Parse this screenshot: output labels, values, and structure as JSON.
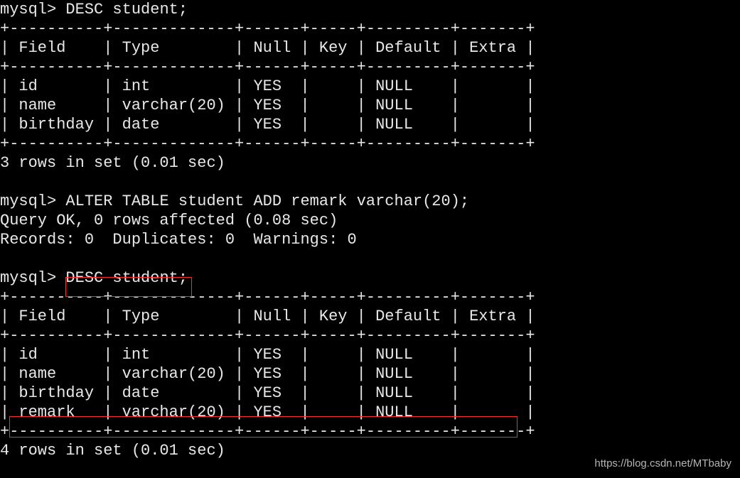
{
  "prompt": "mysql>",
  "cmd1": "DESC student;",
  "sep1": "+----------+-------------+------+-----+---------+-------+",
  "hdr1": "| Field    | Type        | Null | Key | Default | Extra |",
  "t1r1": "| id       | int         | YES  |     | NULL    |       |",
  "t1r2": "| name     | varchar(20) | YES  |     | NULL    |       |",
  "t1r3": "| birthday | date        | YES  |     | NULL    |       |",
  "res1": "3 rows in set (0.01 sec)",
  "cmd2": "ALTER TABLE student ADD remark varchar(20);",
  "ok2": "Query OK, 0 rows affected (0.08 sec)",
  "rec2": "Records: 0  Duplicates: 0  Warnings: 0",
  "cmd3": "DESC student;",
  "t2r1": "| id       | int         | YES  |     | NULL    |       |",
  "t2r2": "| name     | varchar(20) | YES  |     | NULL    |       |",
  "t2r3": "| birthday | date        | YES  |     | NULL    |       |",
  "t2r4": "| remark   | varchar(20) | YES  |     | NULL    |       |",
  "res2": "4 rows in set (0.01 sec)",
  "watermark": "https://blog.csdn.net/MTbaby",
  "chart_data": {
    "type": "table",
    "tables": [
      {
        "title": "DESC student (before ALTER)",
        "columns": [
          "Field",
          "Type",
          "Null",
          "Key",
          "Default",
          "Extra"
        ],
        "rows": [
          [
            "id",
            "int",
            "YES",
            "",
            "NULL",
            ""
          ],
          [
            "name",
            "varchar(20)",
            "YES",
            "",
            "NULL",
            ""
          ],
          [
            "birthday",
            "date",
            "YES",
            "",
            "NULL",
            ""
          ]
        ],
        "footer": "3 rows in set (0.01 sec)"
      },
      {
        "title": "DESC student (after ALTER)",
        "columns": [
          "Field",
          "Type",
          "Null",
          "Key",
          "Default",
          "Extra"
        ],
        "rows": [
          [
            "id",
            "int",
            "YES",
            "",
            "NULL",
            ""
          ],
          [
            "name",
            "varchar(20)",
            "YES",
            "",
            "NULL",
            ""
          ],
          [
            "birthday",
            "date",
            "YES",
            "",
            "NULL",
            ""
          ],
          [
            "remark",
            "varchar(20)",
            "YES",
            "",
            "NULL",
            ""
          ]
        ],
        "footer": "4 rows in set (0.01 sec)"
      }
    ],
    "alter_statement": "ALTER TABLE student ADD remark varchar(20);",
    "alter_result": {
      "msg": "Query OK, 0 rows affected (0.08 sec)",
      "records": 0,
      "duplicates": 0,
      "warnings": 0
    }
  }
}
